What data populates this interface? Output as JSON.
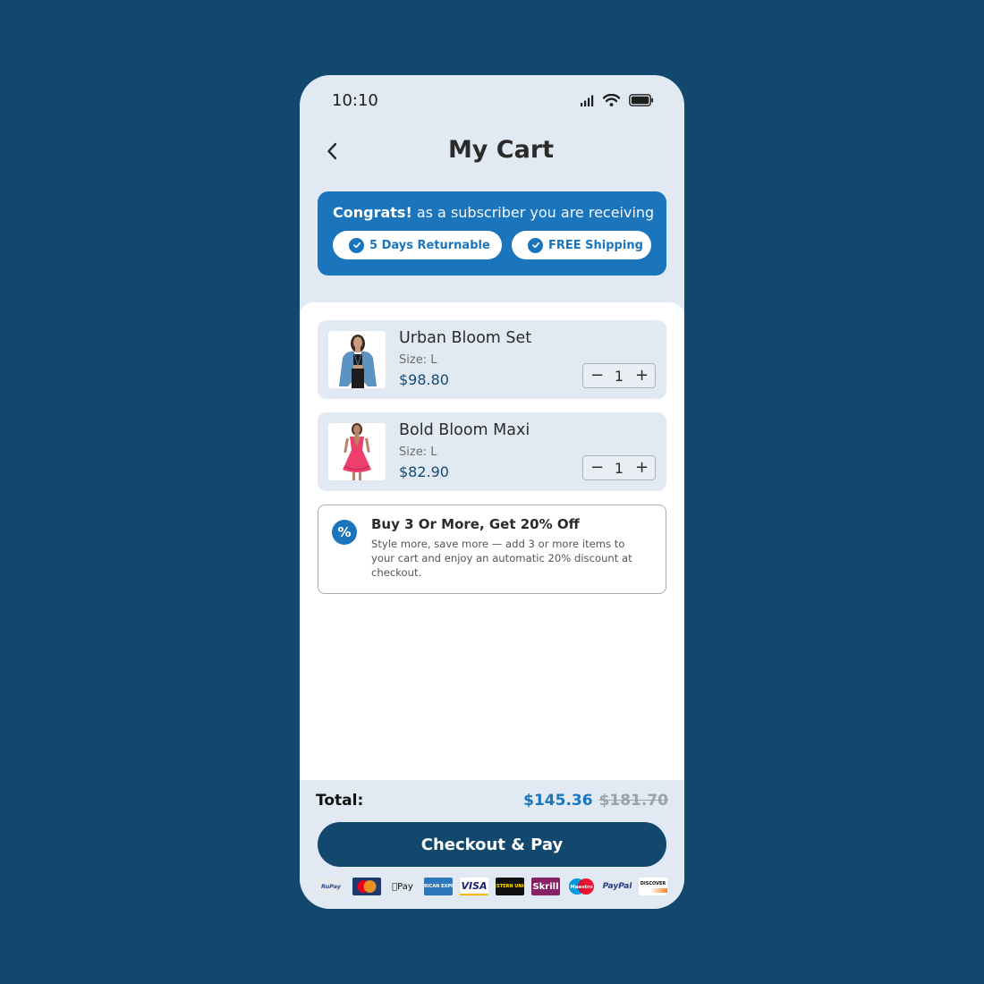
{
  "status_bar": {
    "time": "10:10"
  },
  "header": {
    "title": "My Cart"
  },
  "promo": {
    "headline_bold": "Congrats!",
    "headline_rest": "as a subscriber you are receiving",
    "perks": [
      {
        "label": "5 Days Returnable"
      },
      {
        "label": "FREE Shipping"
      }
    ]
  },
  "cart": {
    "items": [
      {
        "name": "Urban Bloom Set",
        "size": "Size: L",
        "price": "$98.80",
        "quantity": "1",
        "image": "blue-blazer-outfit"
      },
      {
        "name": "Bold Bloom Maxi",
        "size": "Size: L",
        "price": "$82.90",
        "quantity": "1",
        "image": "pink-ruffle-dress"
      }
    ]
  },
  "offer": {
    "icon": "%",
    "title": "Buy 3 Or More, Get 20% Off",
    "description": "Style more, save more — add 3 or more items to your cart and enjoy an automatic 20% discount at checkout."
  },
  "footer": {
    "total_label": "Total:",
    "total_price": "$145.36",
    "original_price": "$181.70",
    "checkout_label": "Checkout & Pay",
    "payment_methods": [
      "RuPay",
      "MasterCard",
      "Apple Pay",
      "American Express",
      "VISA",
      "Western Union",
      "Skrill",
      "Maestro",
      "PayPal",
      "Discover"
    ]
  },
  "colors": {
    "background": "#13486e",
    "accent": "#1a75bd",
    "card": "#e1eaf2"
  }
}
